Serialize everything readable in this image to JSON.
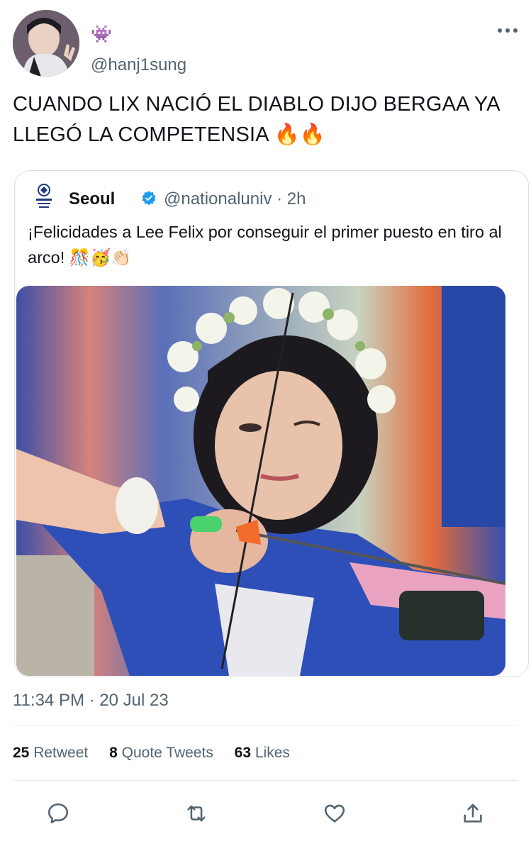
{
  "author": {
    "display_name": "👾",
    "handle": "@hanj1sung"
  },
  "tweet": {
    "text": "CUANDO LIX NACIÓ EL DIABLO DIJO BERGAA YA LLEGÓ LA COMPETENSIA 🔥🔥"
  },
  "quoted": {
    "name": "Seoul",
    "handle_time": "@nationaluniv · 2h",
    "text": "¡Felicidades a Lee Felix por conseguir el primer puesto en tiro al arco! 🎊🥳👏🏻"
  },
  "meta": {
    "timestamp": "11:34 PM · 20 Jul 23"
  },
  "stats": {
    "retweets_count": "25",
    "retweets_label": "Retweet",
    "quotes_count": "8",
    "quotes_label": "Quote Tweets",
    "likes_count": "63",
    "likes_label": "Likes"
  },
  "colors": {
    "accent": "#1d9bf0",
    "secondary_text": "#536471",
    "image_blue": "#2e4fb8"
  },
  "icons": [
    "more-icon",
    "verified-icon",
    "reply-icon",
    "retweet-icon",
    "like-icon",
    "share-icon"
  ]
}
